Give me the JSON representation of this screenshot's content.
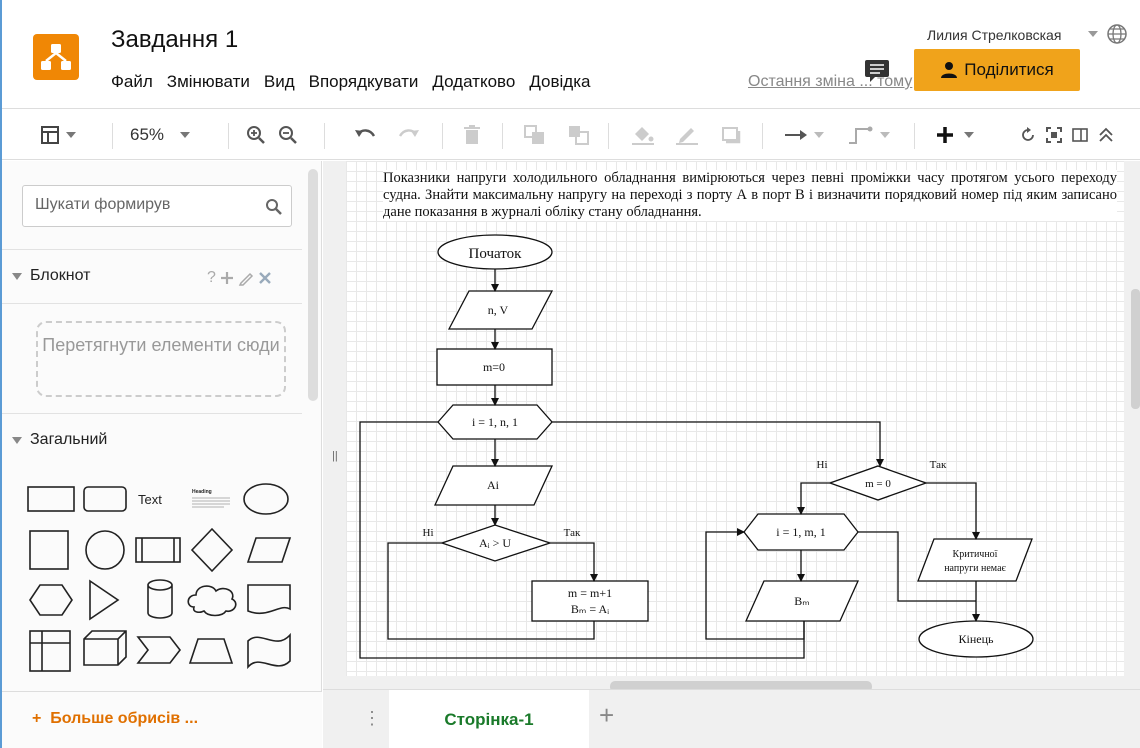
{
  "header": {
    "title": "Завдання 1",
    "menu": [
      "Файл",
      "Змінювати",
      "Вид",
      "Впорядкувати",
      "Додатково",
      "Довідка"
    ],
    "last_change": "Остання зміна ... тому",
    "user": "Лилия Стрелковская",
    "share_label": "Поділитися"
  },
  "toolbar": {
    "zoom": "65%"
  },
  "sidebar": {
    "search_placeholder": "Шукати формирув",
    "scratchpad_title": "Блокнот",
    "dropzone_text": "Перетягнути елементи сюди",
    "general_title": "Загальний",
    "shape_text_label": "Text",
    "shape_heading_label": "Heading",
    "more_shapes": "Больше обрисів ..."
  },
  "canvas": {
    "task_text": "Показники напруги холодильного обладнання вимірюються через певні проміжки часу протягом усього переходу судна. Знайти максимальну напругу на переході з порту А в порт В і визначити порядковий номер під яким записано дане показання в журналі обліку стану обладнання.",
    "flowchart": {
      "start": "Початок",
      "input": "n, V",
      "init": "m=0",
      "loop1": "i = 1, n, 1",
      "read": "Ai",
      "cond1": "Aᵢ > U",
      "no": "Ні",
      "yes": "Так",
      "assign1": "m = m+1",
      "assign2": "Bₘ = Aᵢ",
      "cond2": "m = 0",
      "loop2": "i = 1, m, 1",
      "output": "Bₘ",
      "msg_line1": "Критичної",
      "msg_line2": "напруги немає",
      "end": "Кінець"
    }
  },
  "tabs": {
    "page": "Сторінка-1"
  },
  "colors": {
    "accent": "#f08705",
    "share": "#f0a31b",
    "tab_text": "#1a7a2a",
    "more_shapes": "#e07000"
  }
}
